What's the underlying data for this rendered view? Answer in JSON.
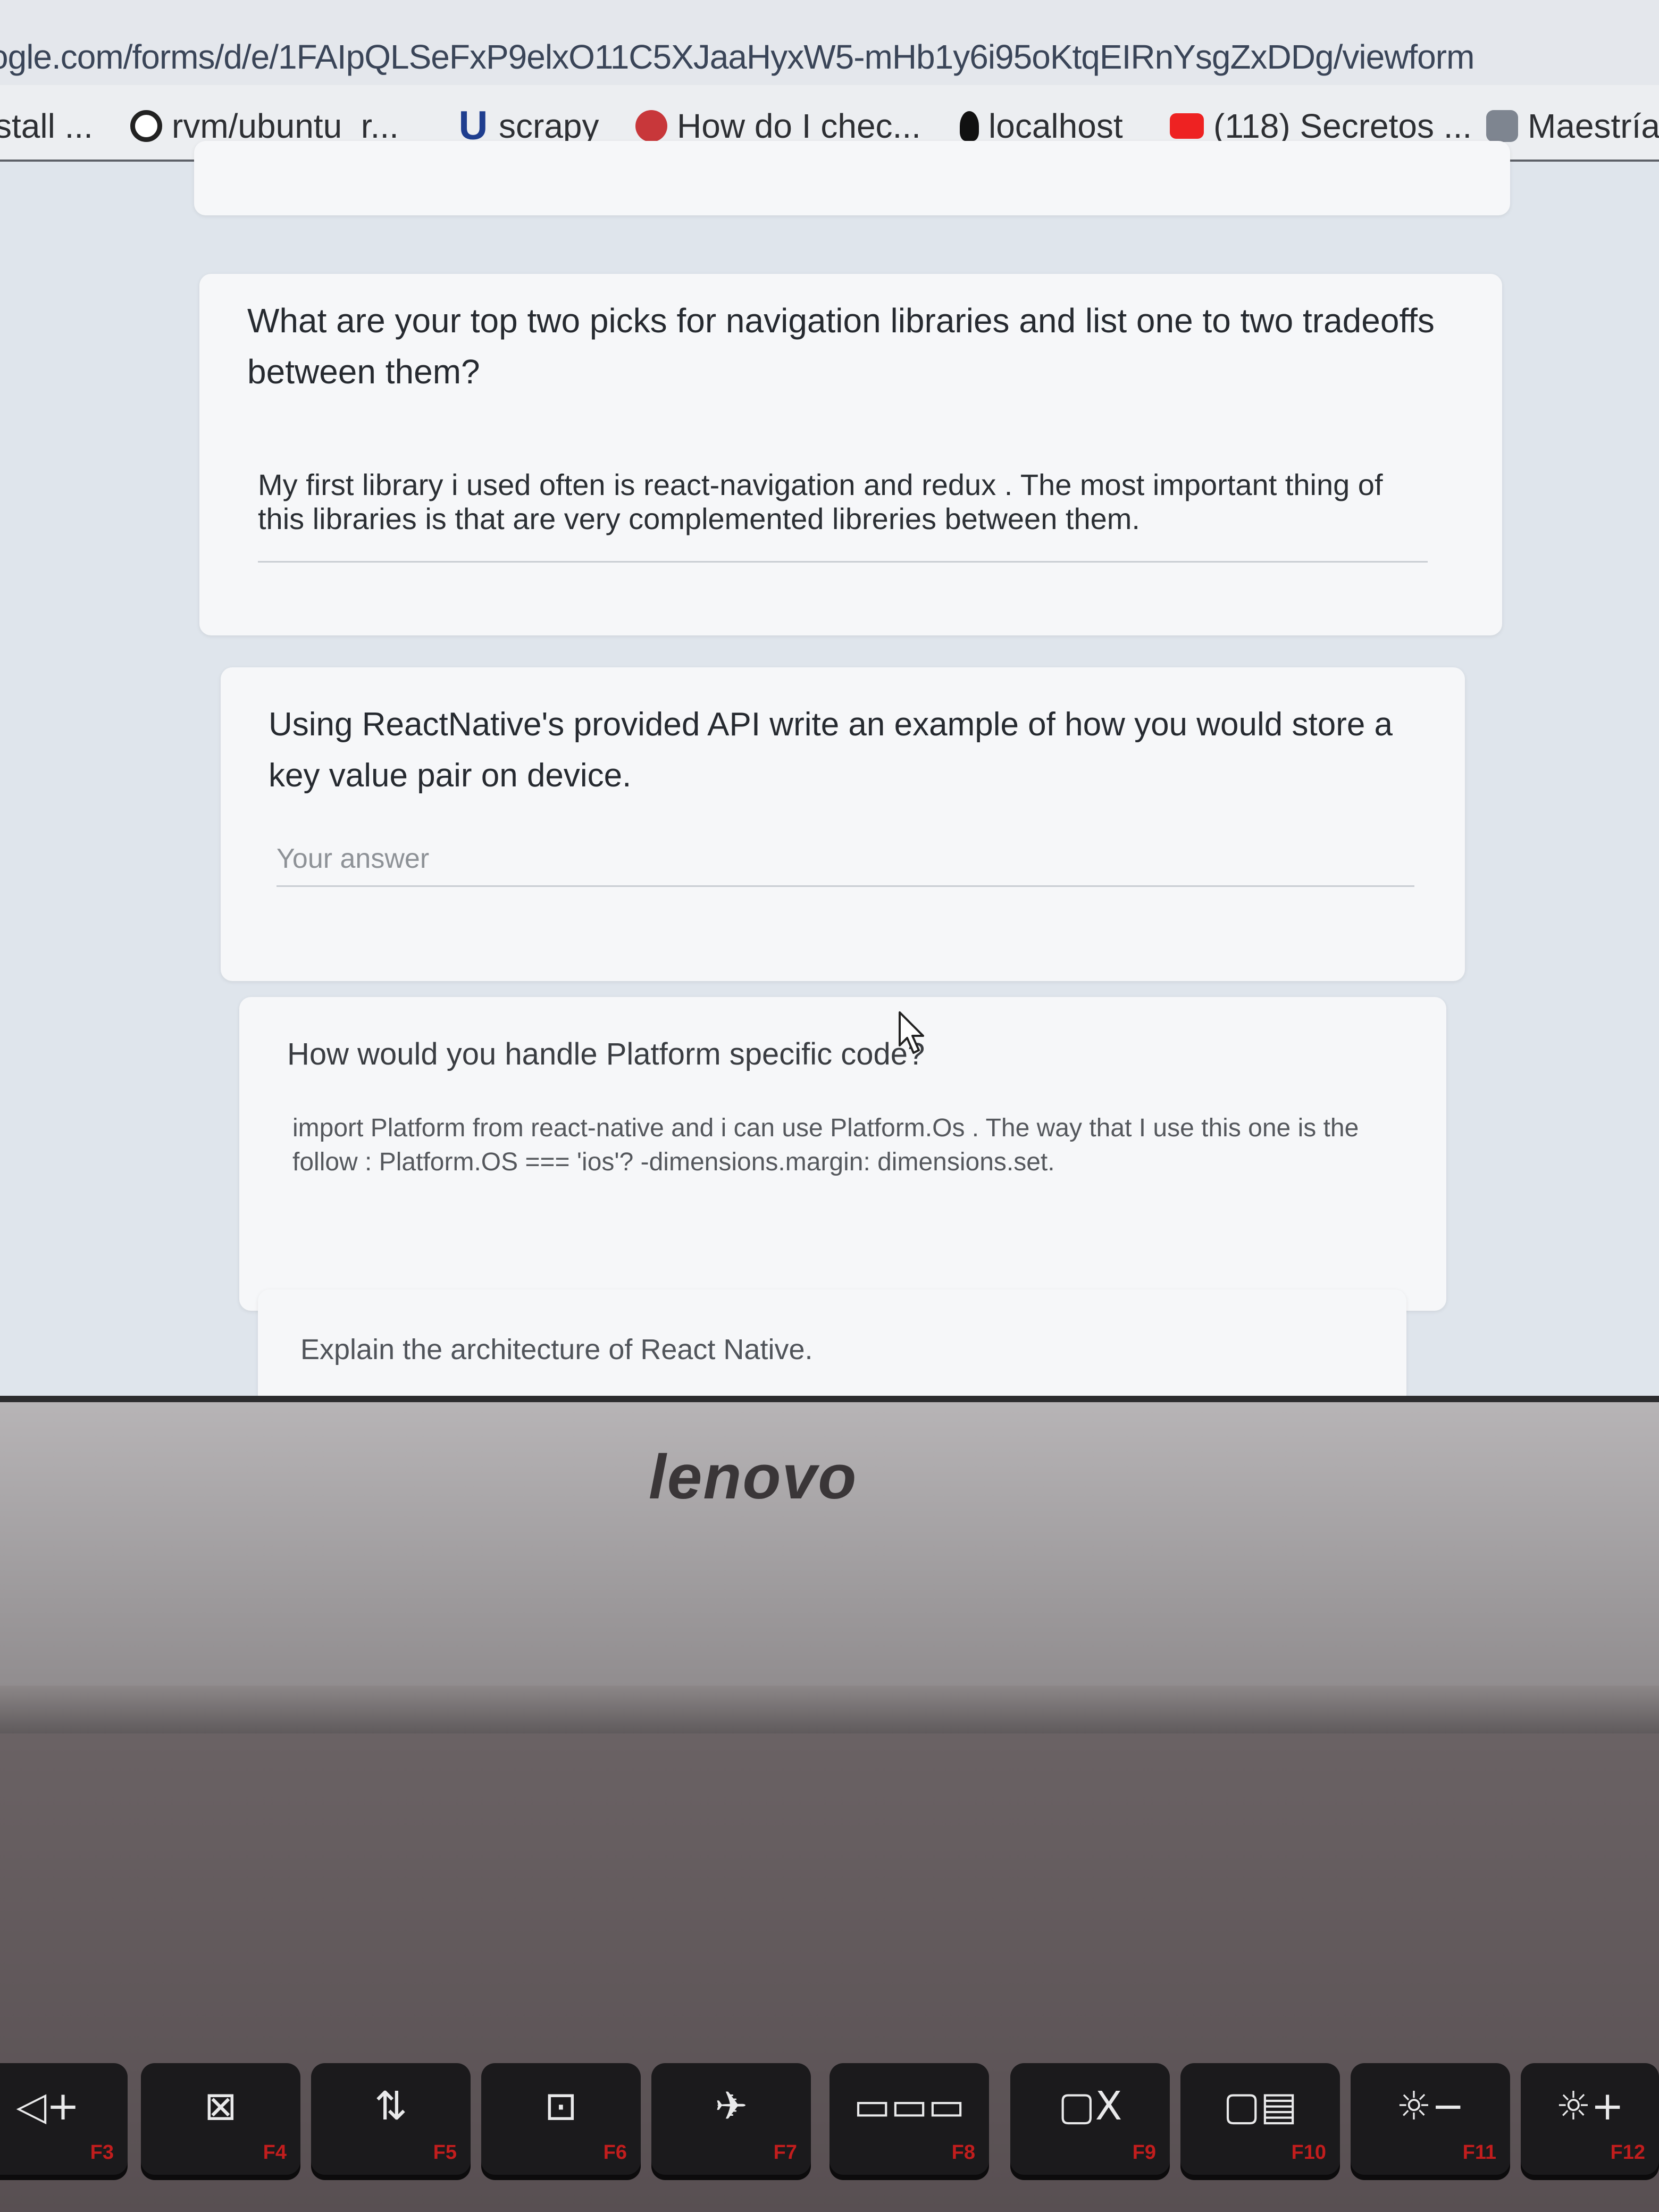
{
  "browser": {
    "url": "ogle.com/forms/d/e/1FAIpQLSeFxP9elxO11C5XJaaHyxW5-mHb1y6i95oKtqEIRnYsgZxDDg/viewform",
    "bookmarks": [
      {
        "label": "stall ...",
        "icon": "none"
      },
      {
        "label": "rvm/ubuntu_r...",
        "icon": "github-icon"
      },
      {
        "label": "scrapy",
        "icon": "u-logo-icon"
      },
      {
        "label": "How do I chec...",
        "icon": "ask-icon"
      },
      {
        "label": "localhost",
        "icon": "lightbulb-icon"
      },
      {
        "label": "(118) Secretos ...",
        "icon": "youtube-icon"
      },
      {
        "label": "Maestría",
        "icon": "gear-icon"
      }
    ]
  },
  "form": {
    "q1": {
      "title": "What are your top two picks for navigation libraries and list one to two tradeoffs between them?",
      "answer": "My first library i used often is react-navigation and redux . The most important thing of this libraries is that are very complemented libreries between them."
    },
    "q2": {
      "title": "Using ReactNative's provided API write an example of how you would store a key value pair on device.",
      "placeholder": "Your answer"
    },
    "q3": {
      "title": "How would you handle Platform specific code?",
      "answer": "import Platform from react-native and i can use Platform.Os . The way that I use this one is the follow :  Platform.OS === 'ios'? -dimensions.margin: dimensions.set."
    },
    "q4": {
      "title": "Explain the architecture of React Native."
    }
  },
  "laptop": {
    "brand": "lenovo",
    "fkeys": [
      {
        "symbol": "◁+",
        "fn": "F3"
      },
      {
        "symbol": "⊠",
        "fn": "F4"
      },
      {
        "symbol": "⇅",
        "fn": "F5"
      },
      {
        "symbol": "⊡",
        "fn": "F6"
      },
      {
        "symbol": "✈",
        "fn": "F7"
      },
      {
        "symbol": "▭▭▭",
        "fn": "F8"
      },
      {
        "symbol": "▢X",
        "fn": "F9"
      },
      {
        "symbol": "▢▤",
        "fn": "F10"
      },
      {
        "symbol": "☼−",
        "fn": "F11"
      },
      {
        "symbol": "☼+",
        "fn": "F12"
      }
    ]
  }
}
